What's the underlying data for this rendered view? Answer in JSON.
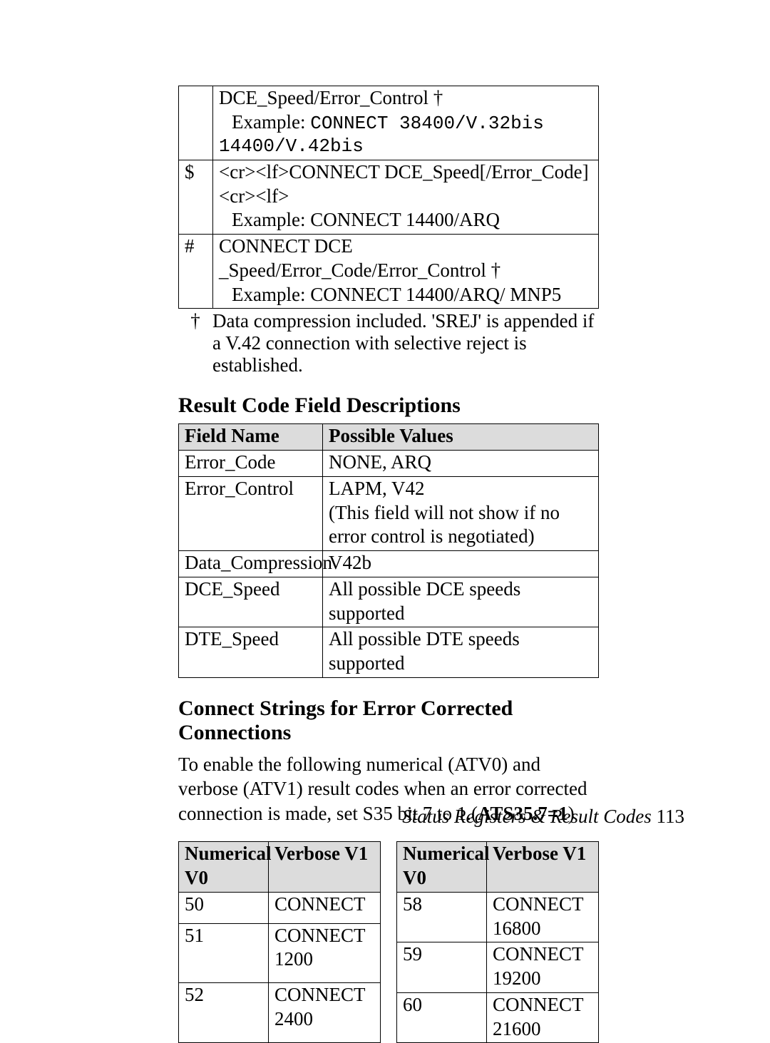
{
  "top_table": {
    "rows": [
      {
        "symbol": "",
        "lines": [
          {
            "kind": "plain",
            "text": "DCE_Speed/Error_Control †"
          },
          {
            "kind": "indent",
            "prefix": "Example: ",
            "mono": "CONNECT 38400/V.32bis"
          },
          {
            "kind": "mono",
            "text": "14400/V.42bis"
          }
        ]
      },
      {
        "symbol": "$",
        "lines": [
          {
            "kind": "plain",
            "text": "<cr><lf>CONNECT DCE_Speed[/Error_Code]<cr><lf>"
          },
          {
            "kind": "indent",
            "prefix": "Example: ",
            "plain": "CONNECT 14400/ARQ"
          }
        ]
      },
      {
        "symbol": "#",
        "lines": [
          {
            "kind": "plain",
            "text": "CONNECT DCE _Speed/Error_Code/Error_Control †"
          },
          {
            "kind": "indent",
            "prefix": "Example: ",
            "plain": "CONNECT 14400/ARQ/ MNP5"
          }
        ]
      }
    ],
    "footnote": {
      "symbol": "†",
      "text": "Data compression included. 'SREJ' is appended if a V.42 connection with selective reject is established."
    }
  },
  "section1_heading": "Result Code Field Descriptions",
  "fields_table": {
    "headers": {
      "c1": "Field Name",
      "c2": "Possible Values"
    },
    "rows": [
      {
        "name": "Error_Code",
        "value": "NONE, ARQ"
      },
      {
        "name": "Error_Control",
        "value": "LAPM, V42\n(This field will not show if no error control is negotiated)"
      },
      {
        "name": "Data_Compression",
        "value": "V42b"
      },
      {
        "name": "DCE_Speed",
        "value": "All possible DCE speeds supported"
      },
      {
        "name": "DTE_Speed",
        "value": "All possible DTE speeds supported"
      }
    ]
  },
  "section2_heading": "Connect Strings for Error Corrected Connections",
  "section2_para_pre": "To enable the following numerical (ATV0) and verbose (ATV1) result codes when an error corrected connection is made, set S35 bit 7 to 1.(",
  "section2_para_bold": "ATS35.7=1",
  "section2_para_post": ")",
  "nv_headers": {
    "c1": "Numerical V0",
    "c2": "Verbose V1"
  },
  "nv_left": [
    {
      "n": "50",
      "v": "CONNECT"
    },
    {
      "n": "51",
      "v": "CONNECT 1200"
    },
    {
      "n": "52",
      "v": "CONNECT 2400"
    }
  ],
  "nv_right": [
    {
      "n": "58",
      "v": "CONNECT 16800"
    },
    {
      "n": "59",
      "v": "CONNECT 19200"
    },
    {
      "n": "60",
      "v": "CONNECT 21600"
    }
  ],
  "footer_text": "Status Registers & Result Codes",
  "footer_page": "  113"
}
